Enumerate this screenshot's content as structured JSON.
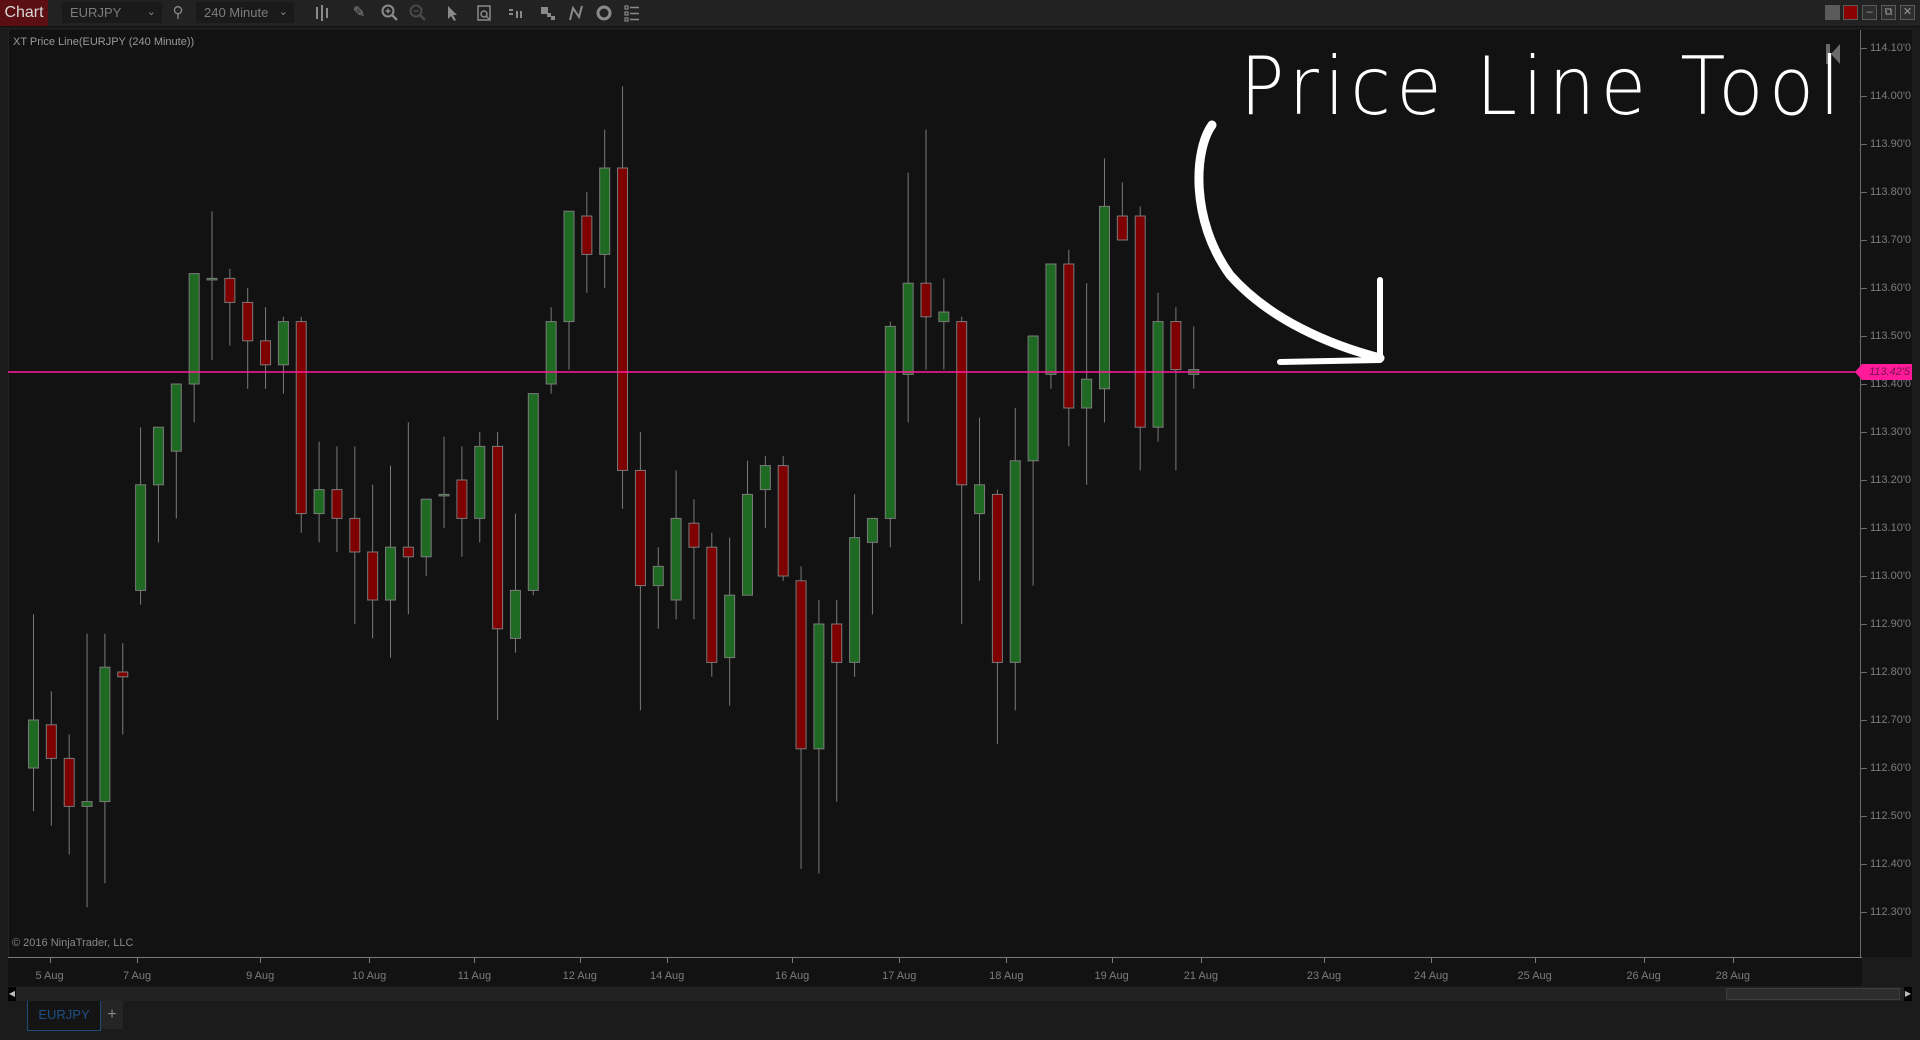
{
  "toolbar": {
    "chart_label": "Chart",
    "instrument": "EURJPY",
    "interval": "240 Minute",
    "icons": [
      "chevron-down-icon",
      "search-icon",
      "bar-type-icon",
      "drawing-tool-icon",
      "zoom-in-icon",
      "zoom-out-icon",
      "pointer-icon",
      "data-box-icon",
      "chart-trader-icon",
      "templates-icon",
      "strategies-icon",
      "indicators-icon",
      "properties-icon"
    ],
    "window_buttons": [
      "minimize-alt",
      "color-red",
      "minimize",
      "restore",
      "close"
    ]
  },
  "chart": {
    "indicator_label": "XT Price Line(EURJPY (240 Minute))",
    "copyright": "© 2016 NinjaTrader, LLC",
    "annotation": "Price Line Tool",
    "colors": {
      "background": "#121212",
      "up_candle": "#1e6a22",
      "down_candle": "#7f0000",
      "wick": "#7a7a7a",
      "price_line": "#ff1a9a"
    }
  },
  "chart_data": {
    "type": "candlestick",
    "title": "XT Price Line(EURJPY (240 Minute))",
    "instrument": "EURJPY",
    "interval": "240 Minute",
    "ylim": [
      112.23,
      114.12
    ],
    "yticks": [
      "114.10'0",
      "114.00'0",
      "113.90'0",
      "113.80'0",
      "113.70'0",
      "113.60'0",
      "113.50'0",
      "113.40'0",
      "113.30'0",
      "113.20'0",
      "113.10'0",
      "113.00'0",
      "112.90'0",
      "112.80'0",
      "112.70'0",
      "112.60'0",
      "112.50'0",
      "112.40'0",
      "112.30'0"
    ],
    "ytick_values": [
      114.1,
      114.0,
      113.9,
      113.8,
      113.7,
      113.6,
      113.5,
      113.4,
      113.3,
      113.2,
      113.1,
      113.0,
      112.9,
      112.8,
      112.7,
      112.6,
      112.5,
      112.4,
      112.3
    ],
    "xticks": [
      {
        "label": "5 Aug",
        "bar": 0.9
      },
      {
        "label": "7 Aug",
        "bar": 5.8
      },
      {
        "label": "9 Aug",
        "bar": 12.7
      },
      {
        "label": "10 Aug",
        "bar": 18.8
      },
      {
        "label": "11 Aug",
        "bar": 24.7
      },
      {
        "label": "12 Aug",
        "bar": 30.6
      },
      {
        "label": "14 Aug",
        "bar": 35.5
      },
      {
        "label": "16 Aug",
        "bar": 42.5
      },
      {
        "label": "17 Aug",
        "bar": 48.5
      },
      {
        "label": "18 Aug",
        "bar": 54.5
      },
      {
        "label": "19 Aug",
        "bar": 60.4
      },
      {
        "label": "21 Aug",
        "bar": 65.4
      },
      {
        "label": "23 Aug",
        "bar": 72.3
      },
      {
        "label": "24 Aug",
        "bar": 78.3
      },
      {
        "label": "25 Aug",
        "bar": 84.1
      },
      {
        "label": "26 Aug",
        "bar": 90.2
      },
      {
        "label": "28 Aug",
        "bar": 95.2
      }
    ],
    "price_line": {
      "value": 113.425,
      "label": "113.42'5"
    },
    "candles": [
      [
        112.6,
        112.92,
        112.51,
        112.7
      ],
      [
        112.69,
        112.76,
        112.48,
        112.62
      ],
      [
        112.62,
        112.67,
        112.42,
        112.52
      ],
      [
        112.52,
        112.88,
        112.31,
        112.53
      ],
      [
        112.53,
        112.88,
        112.36,
        112.81
      ],
      [
        112.8,
        112.86,
        112.67,
        112.79
      ],
      [
        112.97,
        113.31,
        112.94,
        113.19
      ],
      [
        113.19,
        113.26,
        113.07,
        113.31
      ],
      [
        113.26,
        113.38,
        113.12,
        113.4
      ],
      [
        113.4,
        113.57,
        113.32,
        113.63
      ],
      [
        113.62,
        113.76,
        113.45,
        113.62
      ],
      [
        113.62,
        113.64,
        113.48,
        113.57
      ],
      [
        113.57,
        113.6,
        113.39,
        113.49
      ],
      [
        113.49,
        113.56,
        113.39,
        113.44
      ],
      [
        113.44,
        113.54,
        113.38,
        113.53
      ],
      [
        113.53,
        113.54,
        113.09,
        113.13
      ],
      [
        113.13,
        113.28,
        113.07,
        113.18
      ],
      [
        113.18,
        113.27,
        113.05,
        113.12
      ],
      [
        113.12,
        113.27,
        112.9,
        113.05
      ],
      [
        113.05,
        113.19,
        112.87,
        112.95
      ],
      [
        112.95,
        113.23,
        112.83,
        113.06
      ],
      [
        113.06,
        113.32,
        112.92,
        113.04
      ],
      [
        113.04,
        113.16,
        113.0,
        113.16
      ],
      [
        113.17,
        113.29,
        113.1,
        113.17
      ],
      [
        113.2,
        113.27,
        113.04,
        113.12
      ],
      [
        113.12,
        113.3,
        113.07,
        113.27
      ],
      [
        113.27,
        113.3,
        112.7,
        112.89
      ],
      [
        112.87,
        113.13,
        112.84,
        112.97
      ],
      [
        112.97,
        113.38,
        112.96,
        113.38
      ],
      [
        113.4,
        113.56,
        113.38,
        113.53
      ],
      [
        113.53,
        113.76,
        113.43,
        113.76
      ],
      [
        113.75,
        113.8,
        113.59,
        113.67
      ],
      [
        113.67,
        113.93,
        113.6,
        113.85
      ],
      [
        113.85,
        114.02,
        113.14,
        113.22
      ],
      [
        113.22,
        113.3,
        112.72,
        112.98
      ],
      [
        112.98,
        113.06,
        112.89,
        113.02
      ],
      [
        112.95,
        113.22,
        112.91,
        113.12
      ],
      [
        113.11,
        113.16,
        112.91,
        113.06
      ],
      [
        113.06,
        113.09,
        112.79,
        112.82
      ],
      [
        112.83,
        113.08,
        112.73,
        112.96
      ],
      [
        112.96,
        113.24,
        112.96,
        113.17
      ],
      [
        113.18,
        113.25,
        113.1,
        113.23
      ],
      [
        113.23,
        113.25,
        112.99,
        113.0
      ],
      [
        112.99,
        113.02,
        112.39,
        112.64
      ],
      [
        112.64,
        112.95,
        112.38,
        112.9
      ],
      [
        112.9,
        112.95,
        112.53,
        112.82
      ],
      [
        112.82,
        113.17,
        112.79,
        113.08
      ],
      [
        113.07,
        113.12,
        112.92,
        113.12
      ],
      [
        113.12,
        113.53,
        113.06,
        113.52
      ],
      [
        113.42,
        113.84,
        113.32,
        113.61
      ],
      [
        113.61,
        113.93,
        113.43,
        113.54
      ],
      [
        113.53,
        113.62,
        113.43,
        113.55
      ],
      [
        113.53,
        113.54,
        112.9,
        113.19
      ],
      [
        113.13,
        113.33,
        112.99,
        113.19
      ],
      [
        113.17,
        113.18,
        112.65,
        112.82
      ],
      [
        112.82,
        113.35,
        112.72,
        113.24
      ],
      [
        113.24,
        113.45,
        112.98,
        113.5
      ],
      [
        113.42,
        113.64,
        113.39,
        113.65
      ],
      [
        113.65,
        113.68,
        113.27,
        113.35
      ],
      [
        113.35,
        113.61,
        113.19,
        113.41
      ],
      [
        113.39,
        113.87,
        113.32,
        113.77
      ],
      [
        113.75,
        113.82,
        113.7,
        113.7
      ],
      [
        113.75,
        113.77,
        113.22,
        113.31
      ],
      [
        113.31,
        113.59,
        113.28,
        113.53
      ],
      [
        113.53,
        113.56,
        113.22,
        113.43
      ],
      [
        113.42,
        113.52,
        113.39,
        113.43
      ]
    ],
    "candle_format": [
      "open",
      "high",
      "low",
      "close"
    ],
    "legend": "none",
    "grid": false
  },
  "tabs": [
    {
      "label": "EURJPY",
      "active": true
    }
  ],
  "tab_add_label": "+"
}
